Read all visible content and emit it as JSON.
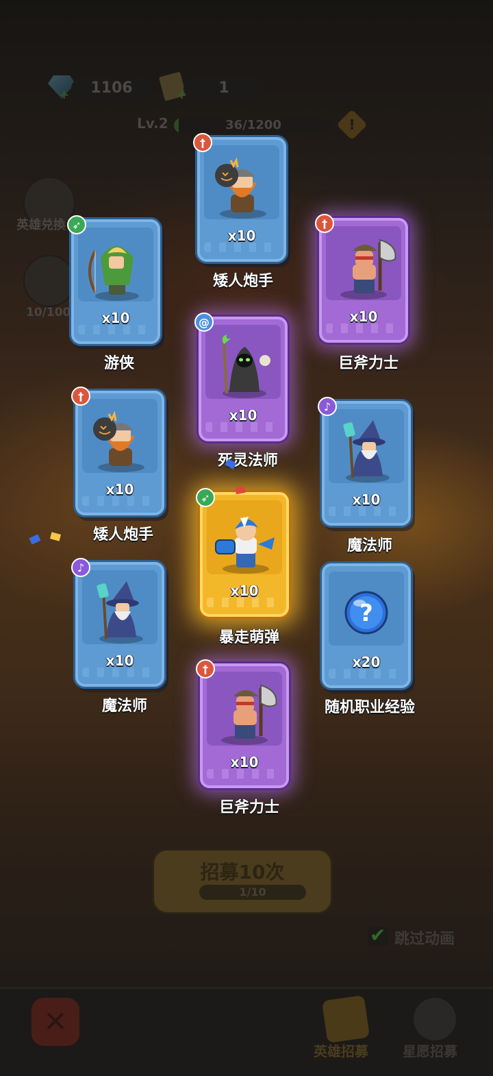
{
  "hud": {
    "gems": "1106",
    "tickets": "1",
    "level": "Lv.2",
    "xp": "36/1200",
    "xp_progress": 0.03,
    "plus_symbol": "+",
    "warning_symbol": "!"
  },
  "side": {
    "hero_exchange_label": "英雄兑換",
    "counter_label": "10/100"
  },
  "cards": [
    {
      "name": "矮人炮手",
      "count": "x10",
      "rarity": "blue",
      "class_icon": "cannon-icon",
      "badge_glyph": "†",
      "hero_icon": "dwarf-bomber-icon"
    },
    {
      "name": "游侠",
      "count": "x10",
      "rarity": "blue",
      "class_icon": "bow-icon",
      "badge_glyph": "➶",
      "hero_icon": "ranger-icon"
    },
    {
      "name": "巨斧力士",
      "count": "x10",
      "rarity": "purple",
      "class_icon": "cannon-icon",
      "badge_glyph": "†",
      "hero_icon": "axe-warrior-icon"
    },
    {
      "name": "死灵法师",
      "count": "x10",
      "rarity": "purple",
      "class_icon": "swirl-icon",
      "badge_glyph": "@",
      "hero_icon": "necromancer-icon"
    },
    {
      "name": "矮人炮手",
      "count": "x10",
      "rarity": "blue",
      "class_icon": "cannon-icon",
      "badge_glyph": "†",
      "hero_icon": "dwarf-bomber-icon"
    },
    {
      "name": "魔法师",
      "count": "x10",
      "rarity": "blue",
      "class_icon": "staff-icon",
      "badge_glyph": "♪",
      "hero_icon": "wizard-icon"
    },
    {
      "name": "暴走萌弹",
      "count": "x10",
      "rarity": "gold",
      "class_icon": "bow-icon",
      "badge_glyph": "➶",
      "hero_icon": "rampage-gunner-icon"
    },
    {
      "name": "魔法师",
      "count": "x10",
      "rarity": "blue",
      "class_icon": "staff-icon",
      "badge_glyph": "♪",
      "hero_icon": "wizard-icon"
    },
    {
      "name": "随机职业经验",
      "count": "x20",
      "rarity": "blue",
      "class_icon": "",
      "badge_glyph": "",
      "hero_icon": "question-orb-icon",
      "question_mark": "?"
    },
    {
      "name": "巨斧力士",
      "count": "x10",
      "rarity": "purple",
      "class_icon": "cannon-icon",
      "badge_glyph": "†",
      "hero_icon": "axe-warrior-icon"
    }
  ],
  "recruit": {
    "label": "招募10次",
    "progress": "1/10"
  },
  "skip_animation": {
    "label": "跳过动画",
    "checked": true,
    "check_glyph": "✔"
  },
  "bottom_nav": {
    "close_glyph": "✕",
    "tab_hero": "英雄招募",
    "tab_star": "星愿招募"
  },
  "colors": {
    "blue_card": "#5e9bd2",
    "purple_card": "#a36ad6",
    "gold_card": "#f3b82a",
    "name_text": "#ffffff"
  }
}
